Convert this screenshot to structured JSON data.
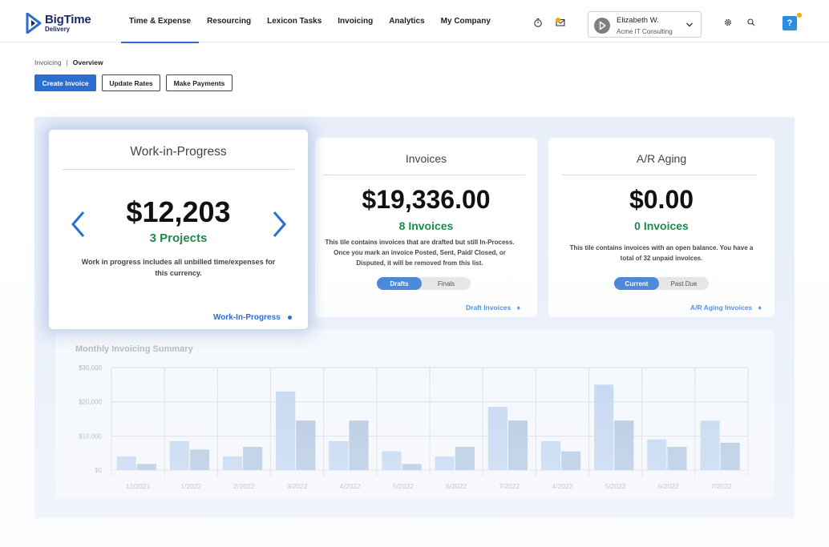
{
  "app": {
    "brand": "BigTime",
    "brand_sub": "Delivery"
  },
  "nav": [
    {
      "label": "Time & Expense",
      "active": true
    },
    {
      "label": "Resourcing"
    },
    {
      "label": "Lexicon Tasks"
    },
    {
      "label": "Invoicing"
    },
    {
      "label": "Analytics"
    },
    {
      "label": "My Company"
    }
  ],
  "header_icons": [
    "timer-icon",
    "inbox-icon",
    "gear-icon",
    "search-icon",
    "help-icon"
  ],
  "user": {
    "name": "Elizabeth W.",
    "company": "Acme IT Consulting"
  },
  "help": {
    "label": "?"
  },
  "breadcrumb": {
    "parent": "Invoicing",
    "separator": "|",
    "current": "Overview"
  },
  "actions": {
    "create": "Create Invoice",
    "update": "Update Rates",
    "payments": "Make Payments"
  },
  "colors": {
    "accent": "#2a6ecf",
    "success": "#1f8a4c",
    "link": "#3c86d8",
    "bar_light": "#b7cfee",
    "bar_dark": "#a3bcdc"
  },
  "wip": {
    "title": "Work-in-Progress",
    "amount": "$12,203",
    "count": "3 Projects",
    "description": "Work in progress includes all unbilled time/expenses for this currency.",
    "link": "Work-In-Progress"
  },
  "invoices": {
    "title": "Invoices",
    "amount": "$19,336.00",
    "count": "8 Invoices",
    "description": "This tile contains invoices that are drafted but still In-Process. Once you mark an invoice Posted, Sent, Paid/ Closed, or Disputed, it will be removed from this list.",
    "toggle": [
      "Drafts",
      "Finals"
    ],
    "link": "Draft Invoices"
  },
  "ar_aging": {
    "title": "A/R Aging",
    "amount": "$0.00",
    "count": "0 Invoices",
    "description": "This tile contains invoices with an open balance. You have a total of 32 unpaid invoices.",
    "toggle": [
      "Current",
      "Past Due"
    ],
    "link": "A/R Aging Invoices"
  },
  "chart_data": {
    "type": "bar",
    "title": "Monthly Invoicing Summary",
    "categories": [
      "12/2021",
      "1/2022",
      "2/2022",
      "3/2022",
      "4/2022",
      "5/2022",
      "6/2022",
      "7/2022",
      "4/2022",
      "5/2022",
      "6/2022",
      "7/2022"
    ],
    "series": [
      {
        "values": [
          4000,
          8500,
          4000,
          23000,
          8500,
          5500,
          4000,
          18500,
          8500,
          25000,
          9000,
          14500
        ]
      },
      {
        "values": [
          1800,
          6000,
          6800,
          14500,
          14500,
          1800,
          6800,
          14500,
          5500,
          14500,
          6800,
          8000
        ]
      }
    ],
    "y_ticks": [
      "$0",
      "$10,000",
      "$20,000",
      "$30,000"
    ],
    "ylim": [
      0,
      30000
    ],
    "grid": true
  }
}
